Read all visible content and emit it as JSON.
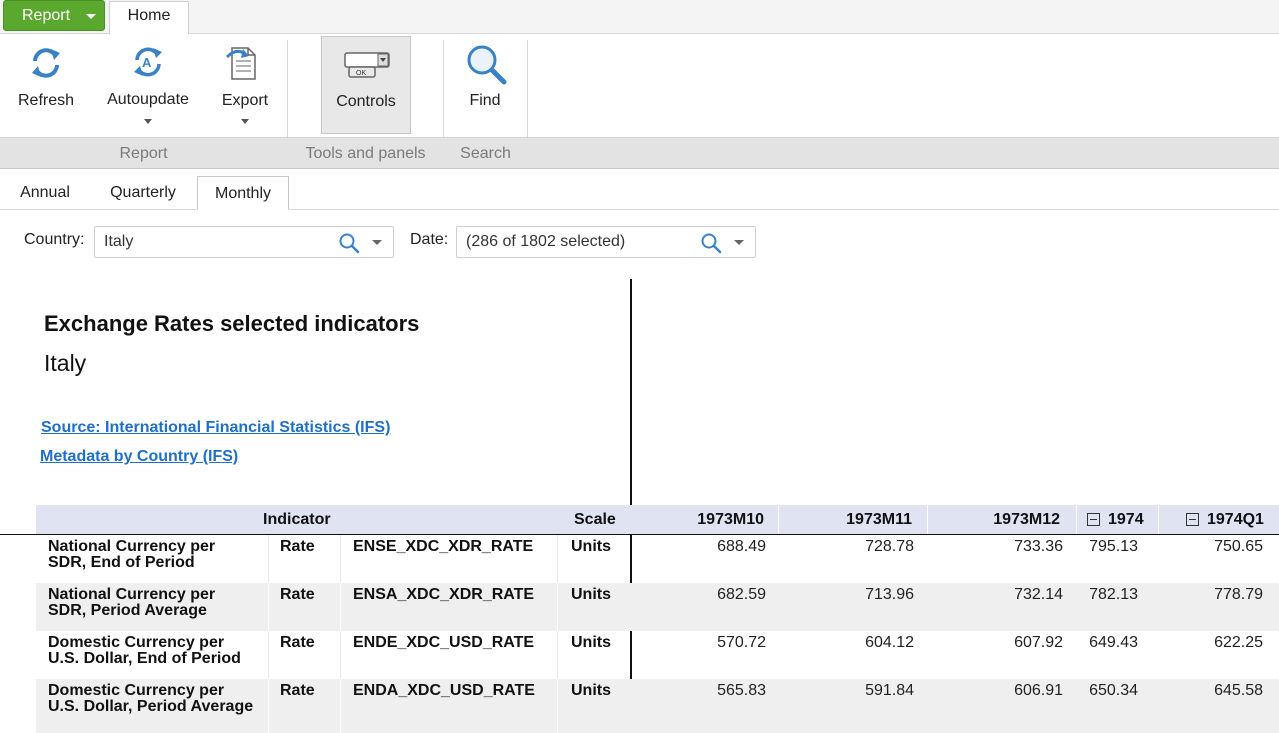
{
  "tabstrip": {
    "report_label": "Report",
    "home_label": "Home"
  },
  "ribbon": {
    "buttons": [
      {
        "label": "Refresh",
        "icon": "refresh-icon"
      },
      {
        "label": "Autoupdate",
        "icon": "autoupdate-icon"
      },
      {
        "label": "Export",
        "icon": "export-icon"
      },
      {
        "label": "Controls",
        "icon": "controls-icon"
      },
      {
        "label": "Find",
        "icon": "find-icon"
      }
    ],
    "groups": [
      "Report",
      "Tools and panels",
      "Search"
    ]
  },
  "view_tabs": [
    "Annual",
    "Quarterly",
    "Monthly"
  ],
  "active_view_tab": "Monthly",
  "filters": {
    "country_label": "Country:",
    "country_value": "Italy",
    "date_label": "Date:",
    "date_value": "(286 of 1802 selected)"
  },
  "report": {
    "title": "Exchange Rates selected indicators",
    "subtitle": "Italy",
    "source_link": "Source: International Financial Statistics (IFS)",
    "metadata_link": "Metadata by Country (IFS)"
  },
  "table": {
    "headers": {
      "indicator": "Indicator",
      "scale": "Scale",
      "periods": [
        "1973M10",
        "1973M11",
        "1973M12",
        "1974",
        "1974Q1"
      ]
    },
    "rows": [
      {
        "name_1": "National Currency per",
        "name_2": "SDR, End of Period",
        "type": "Rate",
        "code": "ENSE_XDC_XDR_RATE",
        "scale": "Units",
        "values": [
          "688.49",
          "728.78",
          "733.36",
          "795.13",
          "750.65"
        ]
      },
      {
        "name_1": "National Currency per",
        "name_2": "SDR, Period Average",
        "type": "Rate",
        "code": "ENSA_XDC_XDR_RATE",
        "scale": "Units",
        "values": [
          "682.59",
          "713.96",
          "732.14",
          "782.13",
          "778.79"
        ]
      },
      {
        "name_1": "Domestic Currency per",
        "name_2": "U.S. Dollar, End of Period",
        "type": "Rate",
        "code": "ENDE_XDC_USD_RATE",
        "scale": "Units",
        "values": [
          "570.72",
          "604.12",
          "607.92",
          "649.43",
          "622.25"
        ]
      },
      {
        "name_1": "Domestic Currency per",
        "name_2": "U.S. Dollar, Period Average",
        "type": "Rate",
        "code": "ENDA_XDC_USD_RATE",
        "scale": "Units",
        "values": [
          "565.83",
          "591.84",
          "606.91",
          "650.34",
          "645.58"
        ]
      }
    ]
  },
  "colors": {
    "report_button": "#5ba82f",
    "link": "#1f6fc6",
    "header_bg": "#dfe3f2",
    "alt_row_bg": "#efefef"
  }
}
